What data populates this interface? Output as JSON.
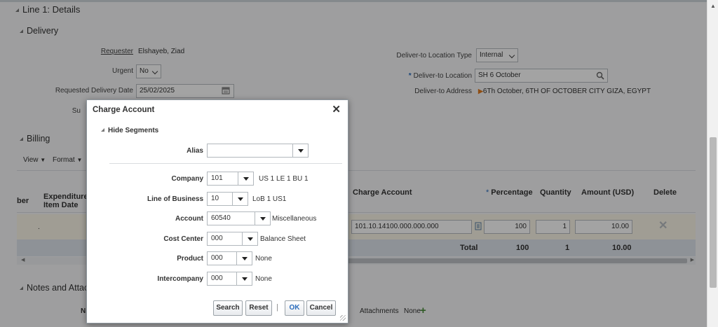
{
  "line_header": "Line 1: Details",
  "delivery": {
    "section_title": "Delivery",
    "requester_label": "Requester",
    "requester_value": "Elshayeb, Ziad",
    "urgent_label": "Urgent",
    "urgent_value": "No",
    "delivery_date_label": "Requested Delivery Date",
    "delivery_date_value": "25/02/2025",
    "su_label": "Su",
    "location_type_label": "Deliver-to Location Type",
    "location_type_value": "Internal",
    "location_required": "*",
    "location_label": "Deliver-to Location",
    "location_value": "SH 6 October",
    "address_label": "Deliver-to Address",
    "address_value": "6Th October, 6TH OF OCTOBER CITY GIZA, EGYPT"
  },
  "billing": {
    "section_title": "Billing",
    "view_label": "View",
    "format_label": "Format",
    "columns": {
      "number": "ber",
      "expenditure_line1": "Expenditure",
      "expenditure_line2": "Item Date",
      "charge_account": "Charge Account",
      "percentage_required": "*",
      "percentage": "Percentage",
      "quantity": "Quantity",
      "amount": "Amount (USD)",
      "delete": "Delete"
    },
    "row": {
      "charge_account": "101.10.14100.000.000.000",
      "percentage": "100",
      "quantity": "1",
      "amount": "10.00"
    },
    "total": {
      "label": "Total",
      "percentage": "100",
      "quantity": "1",
      "amount": "10.00"
    }
  },
  "notes": {
    "section_title": "Notes and Attach",
    "n_label": "N",
    "attachments_label": "Attachments",
    "attachments_value": "None"
  },
  "dialog": {
    "title": "Charge Account",
    "hide_segments": "Hide Segments",
    "alias_label": "Alias",
    "alias_value": "",
    "segments": [
      {
        "label": "Company",
        "value": "101",
        "desc": "US 1 LE 1 BU 1"
      },
      {
        "label": "Line of Business",
        "value": "10",
        "desc": "LoB 1 US1"
      },
      {
        "label": "Account",
        "value": "60540",
        "desc": "Miscellaneous"
      },
      {
        "label": "Cost Center",
        "value": "000",
        "desc": "Balance Sheet"
      },
      {
        "label": "Product",
        "value": "000",
        "desc": "None"
      },
      {
        "label": "Intercompany",
        "value": "000",
        "desc": "None"
      }
    ],
    "buttons": {
      "search": "Search",
      "reset": "Reset",
      "separator": "|",
      "ok": "OK",
      "cancel": "Cancel"
    }
  },
  "colors": {
    "accent": "#2a6cbc",
    "overlay": "#000000"
  },
  "icons": {
    "close": "close-icon",
    "calendar": "calendar-icon",
    "search": "search-icon",
    "add": "plus-icon"
  }
}
